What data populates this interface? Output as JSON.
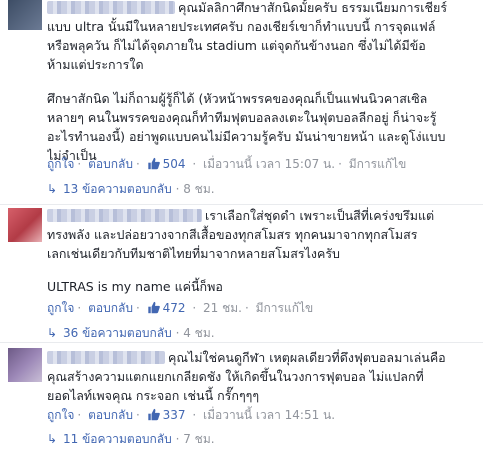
{
  "comments": [
    {
      "text_lines": [
        "คุณมัลลิกาศึกษาสักนิดมั้ยครับ ธรรมเนียมการเชียร์",
        "แบบ ultra นั้นมีในหลายประเทศครับ กองเชียร์เขาก็ทำแบบนี้ การจุดแฟล์",
        "หรือพลุควัน ก็ไม่ได้จุดภายใน stadium แต่จุดกันข้างนอก ซึ่งไม่ได้มีข้อ",
        "ห้ามแต่ประการใด",
        "",
        "ศึกษาสักนิด ไม่ก็ถามผู้รู้ก็ได้ (หัวหน้าพรรคของคุณก็เป็นแฟนนิวคาสเซิล",
        "หลายๆ คนในพรรคของคุณก็ทำทีมฟุตบอลลงเตะในฟุตบอลลีกอยู่ ก็น่าจะรู้",
        "อะไรทำนองนี้) อย่าพูดแบบคนไม่มีความรู้ครับ มันน่าขายหน้า และดูโง่แบบ",
        "ไม่จำเป็น"
      ],
      "like_label": "ถูกใจ",
      "reply_label": "ตอบกลับ",
      "likes": "504",
      "time": "เมื่อวานนี้ เวลา 15:07 น.",
      "edited_label": "มีการแก้ไข",
      "replies_label": "13 ข้อความตอบกลับ",
      "replies_time": "8 ชม."
    },
    {
      "text_lines": [
        "เราเลือกใส่ชุดดำ เพราะเป็นสีที่เคร่งขรึมแต่",
        "ทรงพลัง และปล่อยวางจากสีเสื้อของทุกสโมสร ทุกคนมาจากทุกสโมสร",
        "เลกเช่นเดียวกับทีมชาติไทยที่มาจากหลายสโมสรไงครับ",
        "",
        "ULTRAS is my name แค่นี้ก็พอ"
      ],
      "like_label": "ถูกใจ",
      "reply_label": "ตอบกลับ",
      "likes": "472",
      "time": "21 ชม.",
      "edited_label": "มีการแก้ไข",
      "replies_label": "36 ข้อความตอบกลับ",
      "replies_time": "4 ชม."
    },
    {
      "text_lines": [
        "คุณไม่ใช่คนดูกีฬา เหตุผลเดียวที่ดึงฟุตบอลมาเล่นคือ",
        "คุณสร้างความแตกแยกเกลียดชัง ให้เกิดขึ้นในวงการฟุตบอล ไม่แปลกที่",
        "ยอดไลท์เพจคุณ กระจอก เช่นนี้ กรั๊กๆๆๆ"
      ],
      "like_label": "ถูกใจ",
      "reply_label": "ตอบกลับ",
      "likes": "337",
      "time": "เมื่อวานนี้ เวลา 14:51 น.",
      "replies_label": "11 ข้อความตอบกลับ",
      "replies_time": "7 ชม."
    }
  ],
  "colors": {
    "link": "#4267b2",
    "meta": "#90949c",
    "text": "#1d2129",
    "like_blue": "#4267b2"
  }
}
